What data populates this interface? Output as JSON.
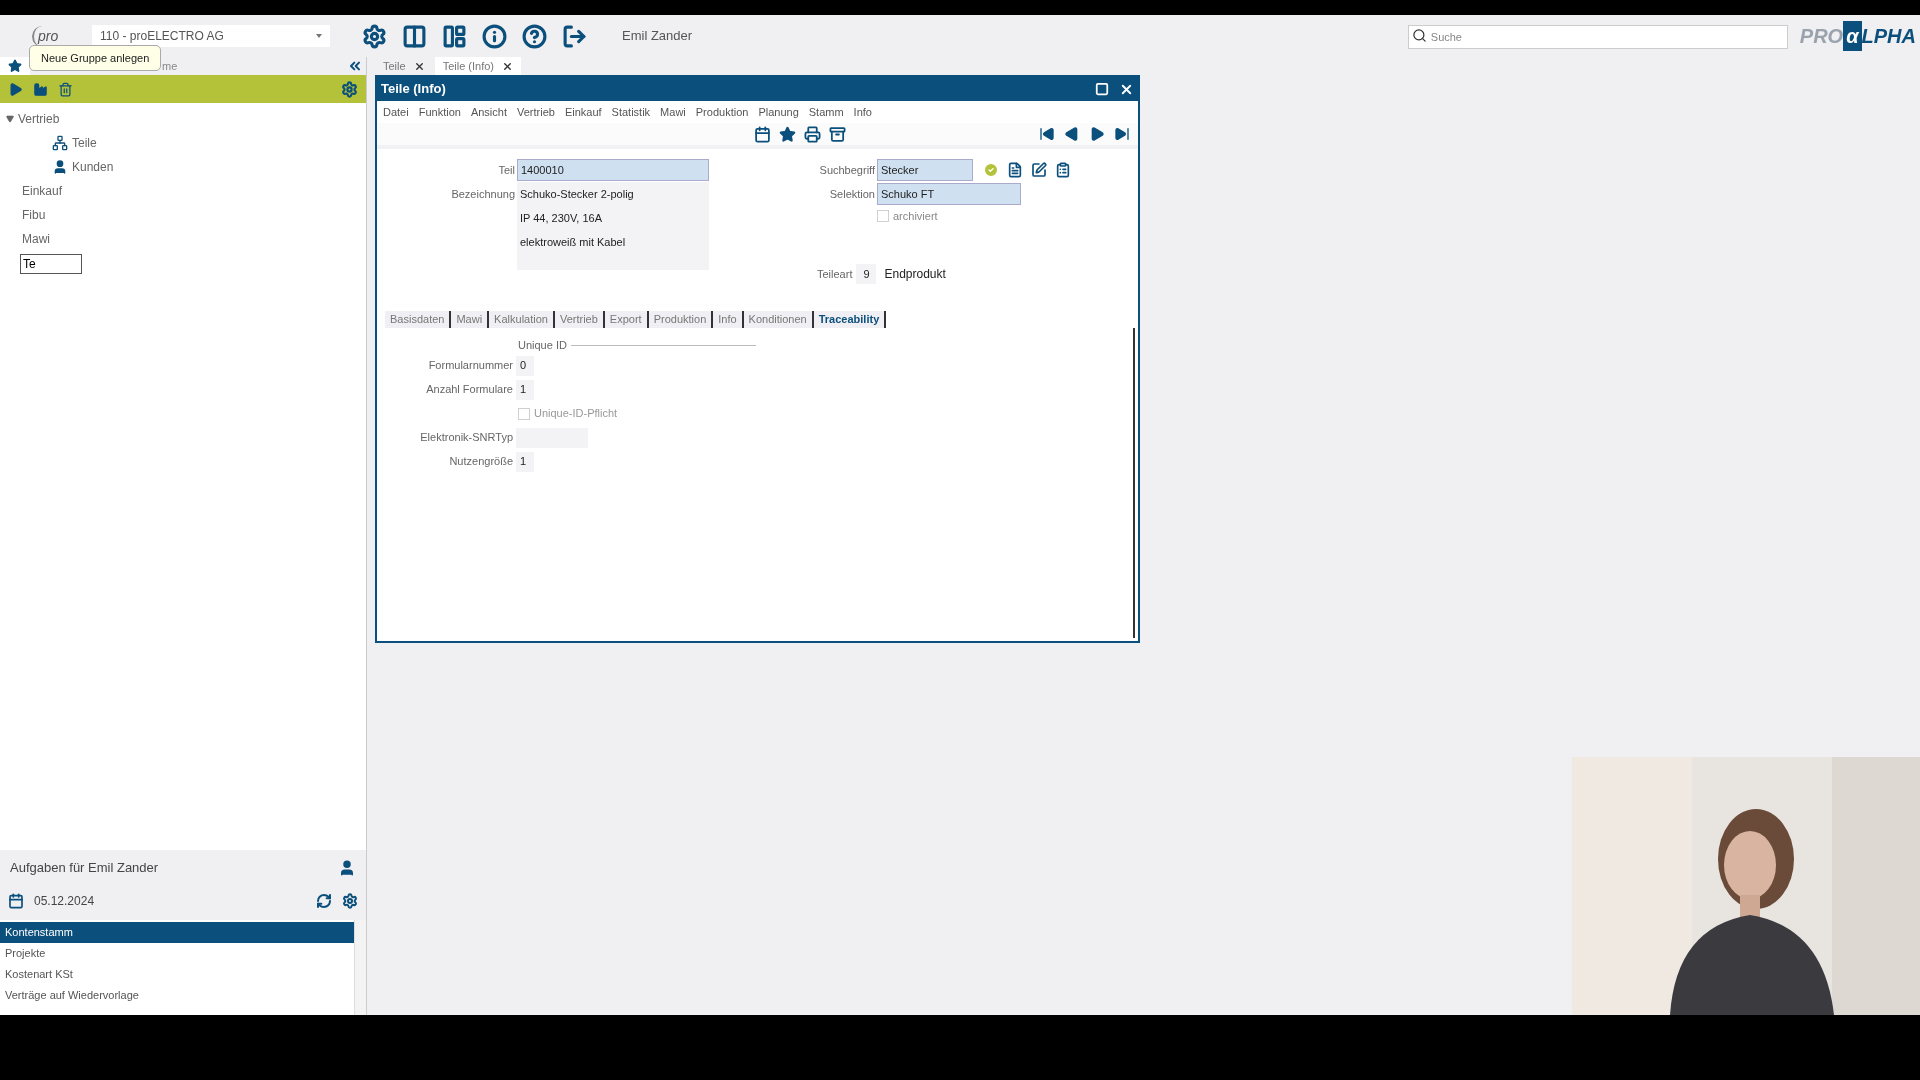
{
  "app_bar": {
    "logo": "pro",
    "company": "110 - proELECTRO AG",
    "user": "Emil Zander",
    "search": {
      "placeholder": "Suche"
    },
    "brand_left": "PRO",
    "brand_mark": "α",
    "brand_right": "LPHA"
  },
  "tooltip": "Neue Gruppe anlegen",
  "sidebar": {
    "tab": "me",
    "tree": [
      {
        "label": "Vertrieb",
        "expanded": true,
        "children": [
          {
            "label": "Teile",
            "kind": "parts"
          },
          {
            "label": "Kunden",
            "kind": "person"
          }
        ]
      },
      {
        "label": "Einkauf"
      },
      {
        "label": "Fibu"
      },
      {
        "label": "Mawi"
      }
    ],
    "new_item": {
      "value": "Te"
    }
  },
  "tasks": {
    "title": "Aufgaben für Emil Zander",
    "date": "05.12.2024",
    "items": [
      {
        "label": "Kontenstamm",
        "selected": true
      },
      {
        "label": "Projekte",
        "selected": false
      },
      {
        "label": "Kostenart KSt",
        "selected": false
      },
      {
        "label": "Verträge auf Wiedervorlage",
        "selected": false
      }
    ]
  },
  "doc_tabs": [
    {
      "label": "Teile",
      "selected": false
    },
    {
      "label": "Teile (Info)",
      "selected": true
    }
  ],
  "window": {
    "title": "Teile (Info)",
    "menu": [
      "Datei",
      "Funktion",
      "Ansicht",
      "Vertrieb",
      "Einkauf",
      "Statistik",
      "Mawi",
      "Produktion",
      "Planung",
      "Stamm",
      "Info"
    ],
    "part": {
      "label": "Teil",
      "value": "1400010"
    },
    "designation": {
      "label": "Bezeichnung",
      "lines": [
        "Schuko-Stecker 2-polig",
        "IP 44, 230V, 16A",
        "elektroweiß mit Kabel"
      ]
    },
    "search_term": {
      "label": "Suchbegriff",
      "value": "Stecker"
    },
    "selection": {
      "label": "Selektion",
      "value": "Schuko FT"
    },
    "archived": {
      "label": "archiviert",
      "checked": false
    },
    "part_type": {
      "label": "Teileart",
      "code": "9",
      "name": "Endprodukt"
    },
    "tabs": [
      {
        "label": "Basisdaten",
        "selected": false
      },
      {
        "label": "Mawi",
        "selected": false
      },
      {
        "label": "Kalkulation",
        "selected": false
      },
      {
        "label": "Vertrieb",
        "selected": false
      },
      {
        "label": "Export",
        "selected": false
      },
      {
        "label": "Produktion",
        "selected": false
      },
      {
        "label": "Info",
        "selected": false
      },
      {
        "label": "Konditionen",
        "selected": false
      },
      {
        "label": "Traceability",
        "selected": true
      }
    ],
    "section": "Unique ID",
    "fields": [
      {
        "kind": "field",
        "label": "Formularnummer",
        "value": "0"
      },
      {
        "kind": "field",
        "label": "Anzahl Formulare",
        "value": "1"
      },
      {
        "kind": "checkbox",
        "label": "Unique-ID-Pflicht",
        "checked": false
      },
      {
        "kind": "field",
        "label": "Elektronik-SNRTyp"
      },
      {
        "kind": "field",
        "label": "Nutzengröße",
        "value": "1"
      }
    ]
  }
}
